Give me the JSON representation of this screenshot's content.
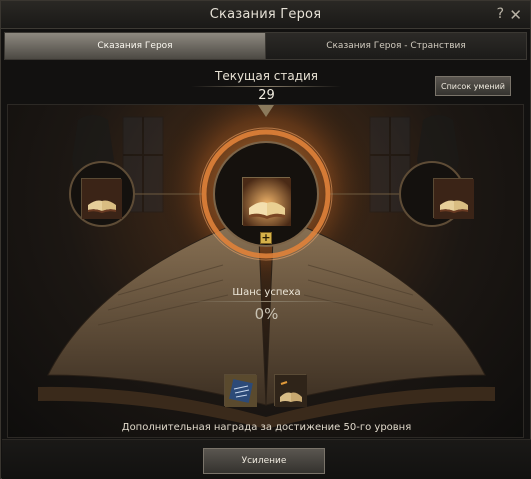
{
  "window": {
    "title": "Сказания Героя",
    "help_glyph": "?",
    "close_glyph": "✕"
  },
  "tabs": [
    {
      "label": "Сказания Героя",
      "active": true
    },
    {
      "label": "Сказания Героя - Странствия",
      "active": false
    }
  ],
  "stage": {
    "label": "Текущая стадия",
    "value": "29"
  },
  "skill_list_button": "Список умений",
  "plus_glyph": "+",
  "success": {
    "label": "Шанс успеха",
    "value": "0%"
  },
  "reward_text": "Дополнительная награда за достижение 50-го уровня",
  "enhance_button": "Усиление",
  "icons": {
    "left_slot": "open-book-icon",
    "main_slot": "glowing-book-icon",
    "right_slot": "open-book-icon",
    "reward_1": "blue-scroll-icon",
    "reward_2": "book-icon"
  },
  "colors": {
    "accent_orange": "#e07a2a",
    "gold": "#d6b24a"
  }
}
